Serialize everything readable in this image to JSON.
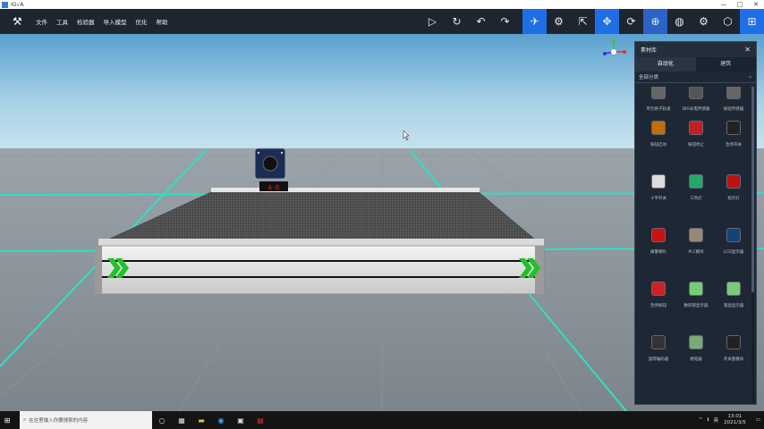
{
  "window": {
    "title": "IO√A",
    "controls": [
      "—",
      "□",
      "✕"
    ]
  },
  "menu": {
    "items": [
      "文件",
      "工具",
      "检验器",
      "导入模型",
      "优化",
      "帮助"
    ]
  },
  "toolbar": {
    "buttons": [
      {
        "name": "play-icon",
        "glyph": "▷"
      },
      {
        "name": "reset-icon",
        "glyph": "↻"
      },
      {
        "name": "undo-icon",
        "glyph": "↶"
      },
      {
        "name": "redo-icon",
        "glyph": "↷"
      },
      {
        "name": "robot-icon",
        "glyph": "✈"
      },
      {
        "name": "camera-icon",
        "glyph": "⚙"
      },
      {
        "name": "select-icon",
        "glyph": "⇱"
      },
      {
        "name": "move-icon",
        "glyph": "✥"
      },
      {
        "name": "rotate-icon",
        "glyph": "⟳"
      },
      {
        "name": "target-icon",
        "glyph": "⊕"
      },
      {
        "name": "globe-icon",
        "glyph": "◍"
      },
      {
        "name": "settings-icon",
        "glyph": "⚙"
      },
      {
        "name": "cube-icon",
        "glyph": "⬡"
      },
      {
        "name": "grid-icon",
        "glyph": "⊞"
      }
    ]
  },
  "scene": {
    "dial_label": "A-D"
  },
  "panel": {
    "title": "素材库",
    "tabs": [
      "自动化",
      "建筑"
    ],
    "filter": "全部分类",
    "items": [
      {
        "label": "单元格子轨道",
        "color": "#666"
      },
      {
        "label": "DIO光电传感器",
        "color": "#555"
      },
      {
        "label": "按钮传感器",
        "color": "#666"
      },
      {
        "label": "按钮启动",
        "color": "#c07000"
      },
      {
        "label": "按钮停止",
        "color": "#c02020"
      },
      {
        "label": "急停开关",
        "color": "#222"
      },
      {
        "label": "十字开关",
        "color": "#ddd"
      },
      {
        "label": "三色灯",
        "color": "#2a6"
      },
      {
        "label": "指示灯",
        "color": "#b11"
      },
      {
        "label": "报警喇叭",
        "color": "#c11"
      },
      {
        "label": "PLC模块",
        "color": "#987"
      },
      {
        "label": "LCD显示器",
        "color": "#147"
      },
      {
        "label": "急停按钮",
        "color": "#c22"
      },
      {
        "label": "数码管显示器",
        "color": "#7c7"
      },
      {
        "label": "液晶显示器",
        "color": "#7c7"
      },
      {
        "label": "旋转编码器",
        "color": "#333"
      },
      {
        "label": "继电器",
        "color": "#7a7"
      },
      {
        "label": "开关量模块",
        "color": "#222"
      }
    ]
  },
  "taskbar": {
    "search_placeholder": "在这里输入你要搜索的内容",
    "apps": [
      "○",
      "▦",
      "▬",
      "◉",
      "▣",
      "▤"
    ],
    "tray": [
      "^",
      "ℹ",
      "英"
    ],
    "time": "13:01",
    "date": "2021/3/5"
  }
}
